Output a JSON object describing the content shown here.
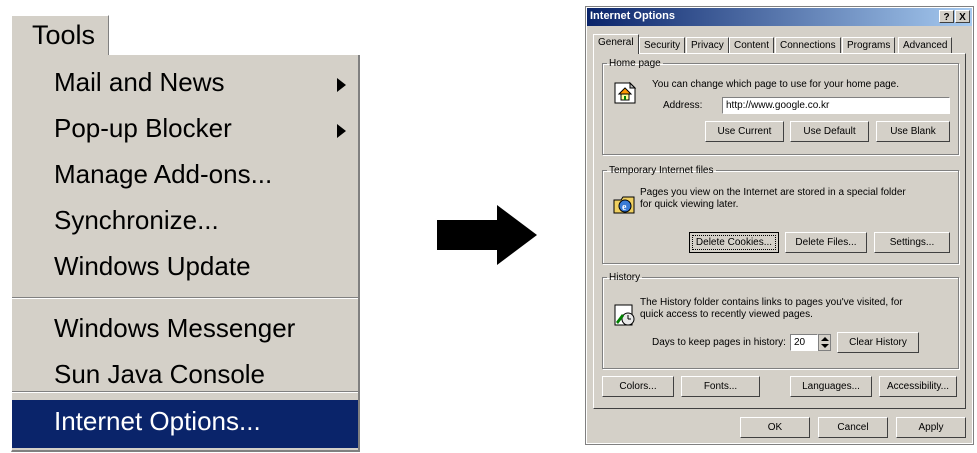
{
  "tools_menu": {
    "title": "Tools",
    "items": [
      {
        "label": "Mail and News",
        "submenu": true
      },
      {
        "label": "Pop-up Blocker",
        "submenu": true
      },
      {
        "label": "Manage Add-ons...",
        "submenu": false
      },
      {
        "label": "Synchronize...",
        "submenu": false
      },
      {
        "label": "Windows Update",
        "submenu": false
      },
      {
        "label": "Windows Messenger",
        "submenu": false
      },
      {
        "label": "Sun Java Console",
        "submenu": false
      },
      {
        "label": "Internet Options...",
        "submenu": false,
        "selected": true
      }
    ]
  },
  "dialog": {
    "title": "Internet Options",
    "help_btn": "?",
    "close_btn": "X",
    "tabs": [
      "General",
      "Security",
      "Privacy",
      "Content",
      "Connections",
      "Programs",
      "Advanced"
    ],
    "home": {
      "legend": "Home page",
      "desc": "You can change which page to use for your home page.",
      "address_label": "Address:",
      "address_value": "http://www.google.co.kr",
      "use_current": "Use Current",
      "use_default": "Use Default",
      "use_blank": "Use Blank"
    },
    "temp": {
      "legend": "Temporary Internet files",
      "desc1": "Pages you view on the Internet are stored in a special folder",
      "desc2": "for quick viewing later.",
      "delete_cookies": "Delete Cookies...",
      "delete_files": "Delete Files...",
      "settings": "Settings..."
    },
    "history": {
      "legend": "History",
      "desc1": "The History folder contains links to pages you've visited, for",
      "desc2": "quick access to recently viewed pages.",
      "days_label": "Days to keep pages in history:",
      "days_value": "20",
      "clear": "Clear History"
    },
    "bottom": {
      "colors": "Colors...",
      "fonts": "Fonts...",
      "languages": "Languages...",
      "accessibility": "Accessibility..."
    },
    "ok": "OK",
    "cancel": "Cancel",
    "apply": "Apply"
  },
  "icons": {
    "transition": "right-arrow-icon",
    "home": "home-page-icon",
    "temp": "ie-temp-files-icon",
    "history": "history-icon"
  }
}
